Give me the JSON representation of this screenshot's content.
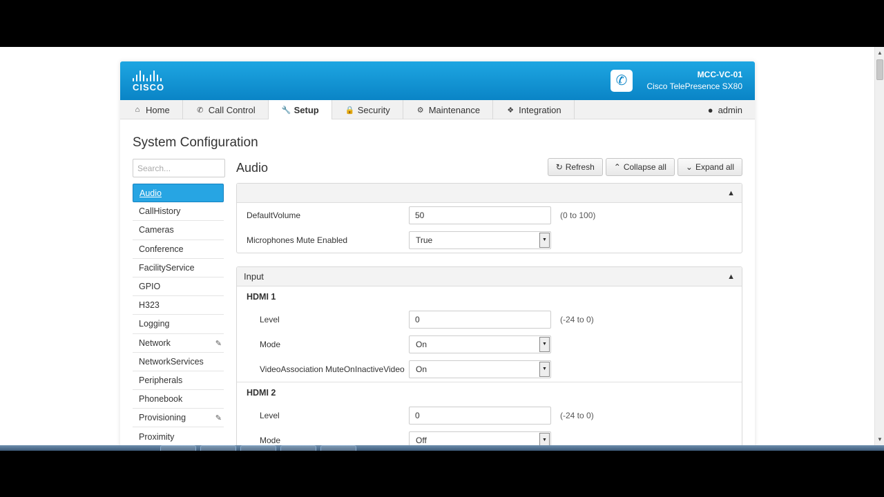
{
  "header": {
    "logo_text": "CISCO",
    "device_name": "MCC-VC-01",
    "device_model": "Cisco TelePresence SX80"
  },
  "nav": {
    "items": [
      {
        "label": "Home",
        "icon": "home-icon"
      },
      {
        "label": "Call Control",
        "icon": "phone-icon"
      },
      {
        "label": "Setup",
        "icon": "wrench-icon",
        "active": true
      },
      {
        "label": "Security",
        "icon": "lock-icon"
      },
      {
        "label": "Maintenance",
        "icon": "gear-icon"
      },
      {
        "label": "Integration",
        "icon": "puzzle-icon"
      }
    ],
    "user": "admin"
  },
  "page": {
    "title": "System Configuration",
    "search_placeholder": "Search..."
  },
  "sidebar": {
    "items": [
      {
        "label": "Audio",
        "active": true
      },
      {
        "label": "CallHistory"
      },
      {
        "label": "Cameras"
      },
      {
        "label": "Conference"
      },
      {
        "label": "FacilityService"
      },
      {
        "label": "GPIO"
      },
      {
        "label": "H323"
      },
      {
        "label": "Logging"
      },
      {
        "label": "Network",
        "edited": true
      },
      {
        "label": "NetworkServices"
      },
      {
        "label": "Peripherals"
      },
      {
        "label": "Phonebook"
      },
      {
        "label": "Provisioning",
        "edited": true
      },
      {
        "label": "Proximity"
      }
    ]
  },
  "main": {
    "title": "Audio",
    "buttons": {
      "refresh": "Refresh",
      "collapse": "Collapse all",
      "expand": "Expand all"
    },
    "general": {
      "default_volume": {
        "label": "DefaultVolume",
        "value": "50",
        "range": "(0 to 100)"
      },
      "mic_mute": {
        "label": "Microphones Mute Enabled",
        "value": "True"
      }
    },
    "input": {
      "title": "Input",
      "hdmi1": {
        "title": "HDMI 1",
        "level": {
          "label": "Level",
          "value": "0",
          "range": "(-24 to 0)"
        },
        "mode": {
          "label": "Mode",
          "value": "On"
        },
        "video_assoc": {
          "label": "VideoAssociation MuteOnInactiveVideo",
          "value": "On"
        }
      },
      "hdmi2": {
        "title": "HDMI 2",
        "level": {
          "label": "Level",
          "value": "0",
          "range": "(-24 to 0)"
        },
        "mode": {
          "label": "Mode",
          "value": "Off"
        }
      }
    }
  },
  "colors": {
    "header_top": "#1ea6e2",
    "header_bottom": "#0a84c6",
    "active_sidebar": "#27a5e3"
  }
}
